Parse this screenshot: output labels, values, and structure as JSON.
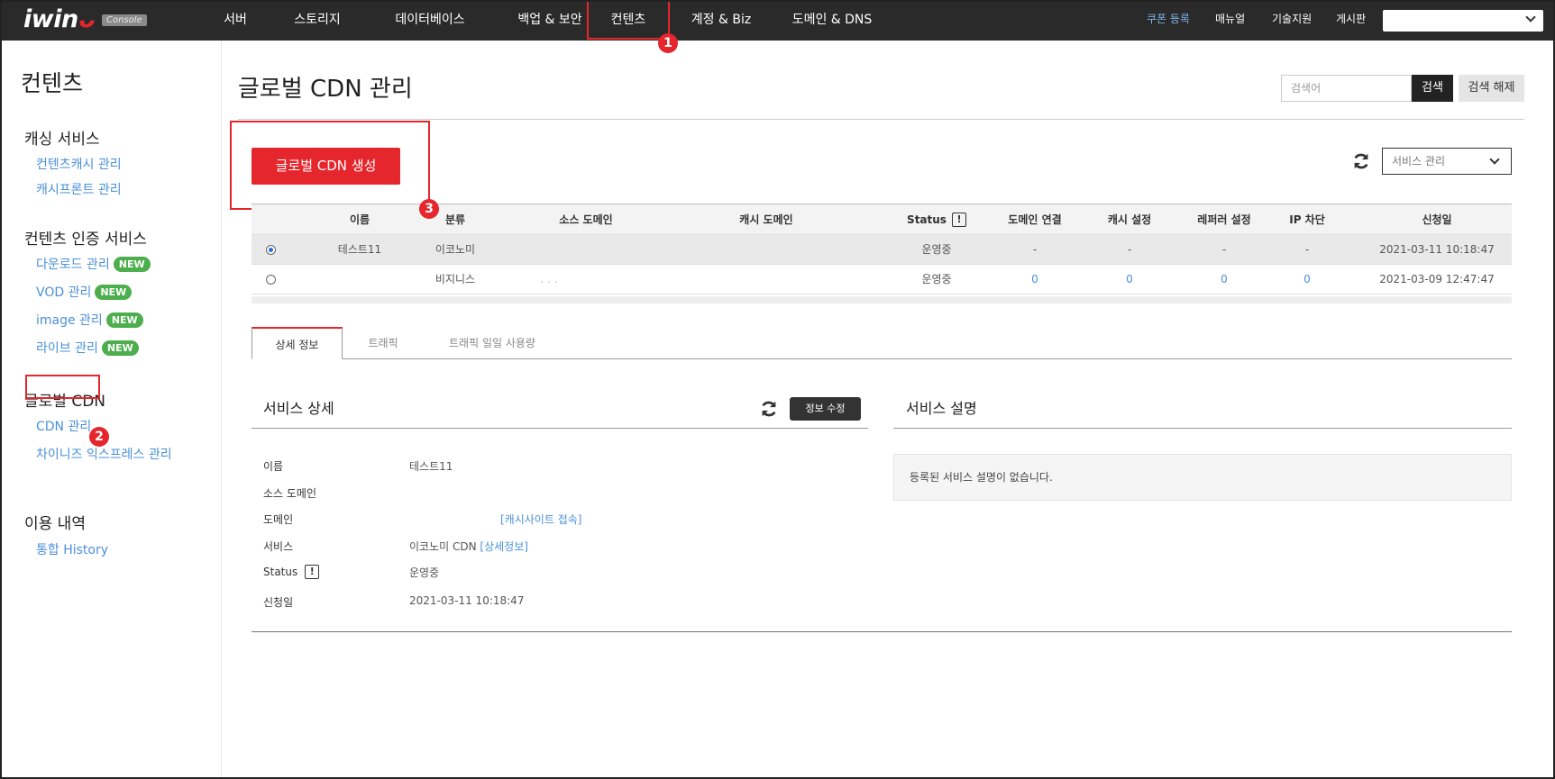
{
  "header": {
    "logo_text": "iwin",
    "logo_badge": "Console",
    "nav": [
      {
        "label": "서버"
      },
      {
        "label": "스토리지"
      },
      {
        "label": "데이터베이스"
      },
      {
        "label": "백업 & 보안"
      },
      {
        "label": "컨텐츠"
      },
      {
        "label": "계정 & Biz"
      },
      {
        "label": "도메인 & DNS"
      }
    ],
    "links": {
      "coupon": "쿠폰 등록",
      "manual": "매뉴얼",
      "support": "기술지원",
      "board": "게시판"
    },
    "account_select": ""
  },
  "annotations": {
    "one": "1",
    "two": "2",
    "three": "3"
  },
  "sidebar": {
    "title": "컨텐츠",
    "sections": [
      {
        "title": "캐싱 서비스",
        "items": [
          {
            "label": "컨텐츠캐시 관리"
          },
          {
            "label": "캐시프론트 관리"
          }
        ]
      },
      {
        "title": "컨텐츠 인증 서비스",
        "items": [
          {
            "label": "다운로드 관리",
            "badge": "NEW"
          },
          {
            "label": "VOD 관리",
            "badge": "NEW"
          },
          {
            "label": "image 관리",
            "badge": "NEW"
          },
          {
            "label": "라이브 관리",
            "badge": "NEW"
          }
        ]
      },
      {
        "title": "글로벌 CDN",
        "items": [
          {
            "label": "CDN 관리"
          },
          {
            "label": "차이니즈 익스프레스 관리"
          }
        ]
      },
      {
        "title": "이용 내역",
        "items": [
          {
            "label": "통합 History"
          }
        ]
      }
    ]
  },
  "main": {
    "title": "글로벌 CDN 관리",
    "search": {
      "placeholder": "검색어",
      "button": "검색",
      "reset": "검색 해제"
    },
    "create_button": "글로벌 CDN 생성",
    "service_select": "서비스 관리",
    "table": {
      "headers": [
        "이름",
        "분류",
        "소스 도메인",
        "캐시 도메인",
        "Status",
        "도메인 연결",
        "캐시 설정",
        "레퍼러 설정",
        "IP 차단",
        "신청일"
      ],
      "status_icon": "!",
      "rows": [
        {
          "selected": true,
          "name": "테스트11",
          "type": "이코노미",
          "source": "",
          "cache": "",
          "status": "운영중",
          "domain_link": "-",
          "cache_setting": "-",
          "referer": "-",
          "ip_block": "-",
          "date": "2021-03-11 10:18:47"
        },
        {
          "selected": false,
          "name": "",
          "type": "비지니스",
          "source": "",
          "cache": ". . .",
          "status": "운영중",
          "domain_link": "0",
          "cache_setting": "0",
          "referer": "0",
          "ip_block": "0",
          "date": "2021-03-09 12:47:47"
        }
      ]
    },
    "tabs": [
      {
        "label": "상세 정보"
      },
      {
        "label": "트래픽"
      },
      {
        "label": "트래픽 일일 사용량"
      }
    ],
    "detail": {
      "title": "서비스 상세",
      "edit_button": "정보 수정",
      "fields": {
        "name_label": "이름",
        "name_value": "테스트11",
        "source_label": "소스 도메인",
        "domain_label": "도메인",
        "domain_link": "[캐시사이트 접속]",
        "service_label": "서비스",
        "service_value": "이코노미 CDN",
        "service_link": "[상세정보]",
        "status_label": "Status",
        "status_value": "운영중",
        "date_label": "신청일",
        "date_value": "2021-03-11 10:18:47"
      }
    },
    "description": {
      "title": "서비스 설명",
      "text": "등록된 서비스 설명이 없습니다."
    }
  },
  "colors": {
    "accent": "#e5262c",
    "link": "#4a90d9",
    "badge_green": "#4cae4c",
    "nav_bg": "#2a2a2a"
  }
}
